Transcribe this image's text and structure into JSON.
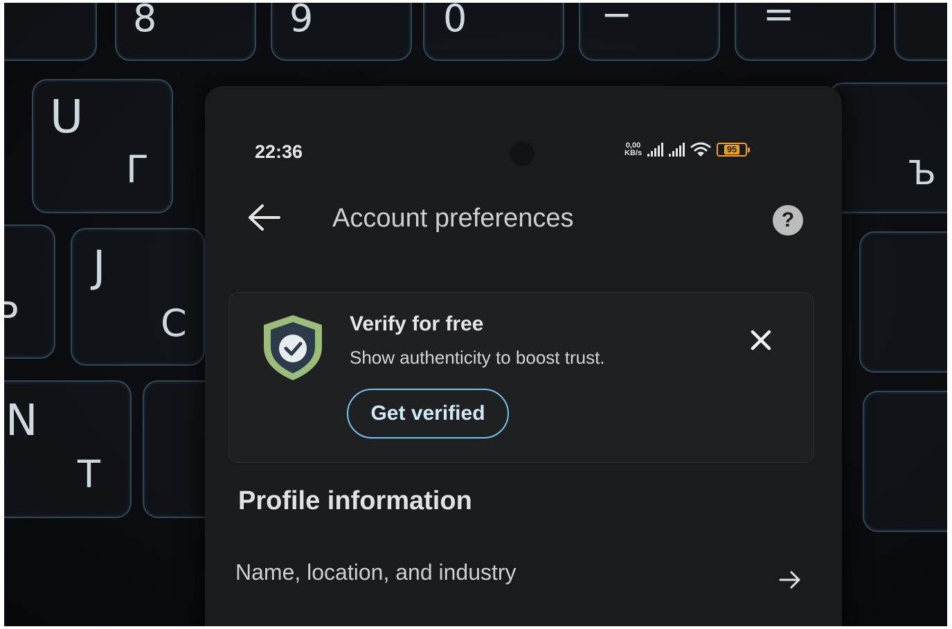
{
  "status_bar": {
    "time": "22:36",
    "network_speed_value": "0,00",
    "network_speed_unit": "KB/s",
    "battery": "95"
  },
  "header": {
    "back_icon": "arrow-left-icon",
    "title": "Account preferences",
    "help_icon": "question-mark-icon",
    "help_symbol": "?"
  },
  "verify_card": {
    "icon": "shield-check-icon",
    "title": "Verify for free",
    "subtitle": "Show authenticity to boost trust.",
    "button_label": "Get verified",
    "close_icon": "close-icon",
    "accent_color": "#72c3ef",
    "shield_color": "#9bbd7a"
  },
  "profile_section": {
    "title": "Profile information",
    "items": [
      {
        "label": "Name, location, and industry",
        "icon": "arrow-right-icon"
      }
    ]
  },
  "background": {
    "keyboard_glyphs": [
      "8",
      "9",
      "0",
      "−",
      "=",
      "U",
      "Г",
      "J",
      "P",
      "C",
      "N",
      "T",
      "Ъ"
    ]
  }
}
